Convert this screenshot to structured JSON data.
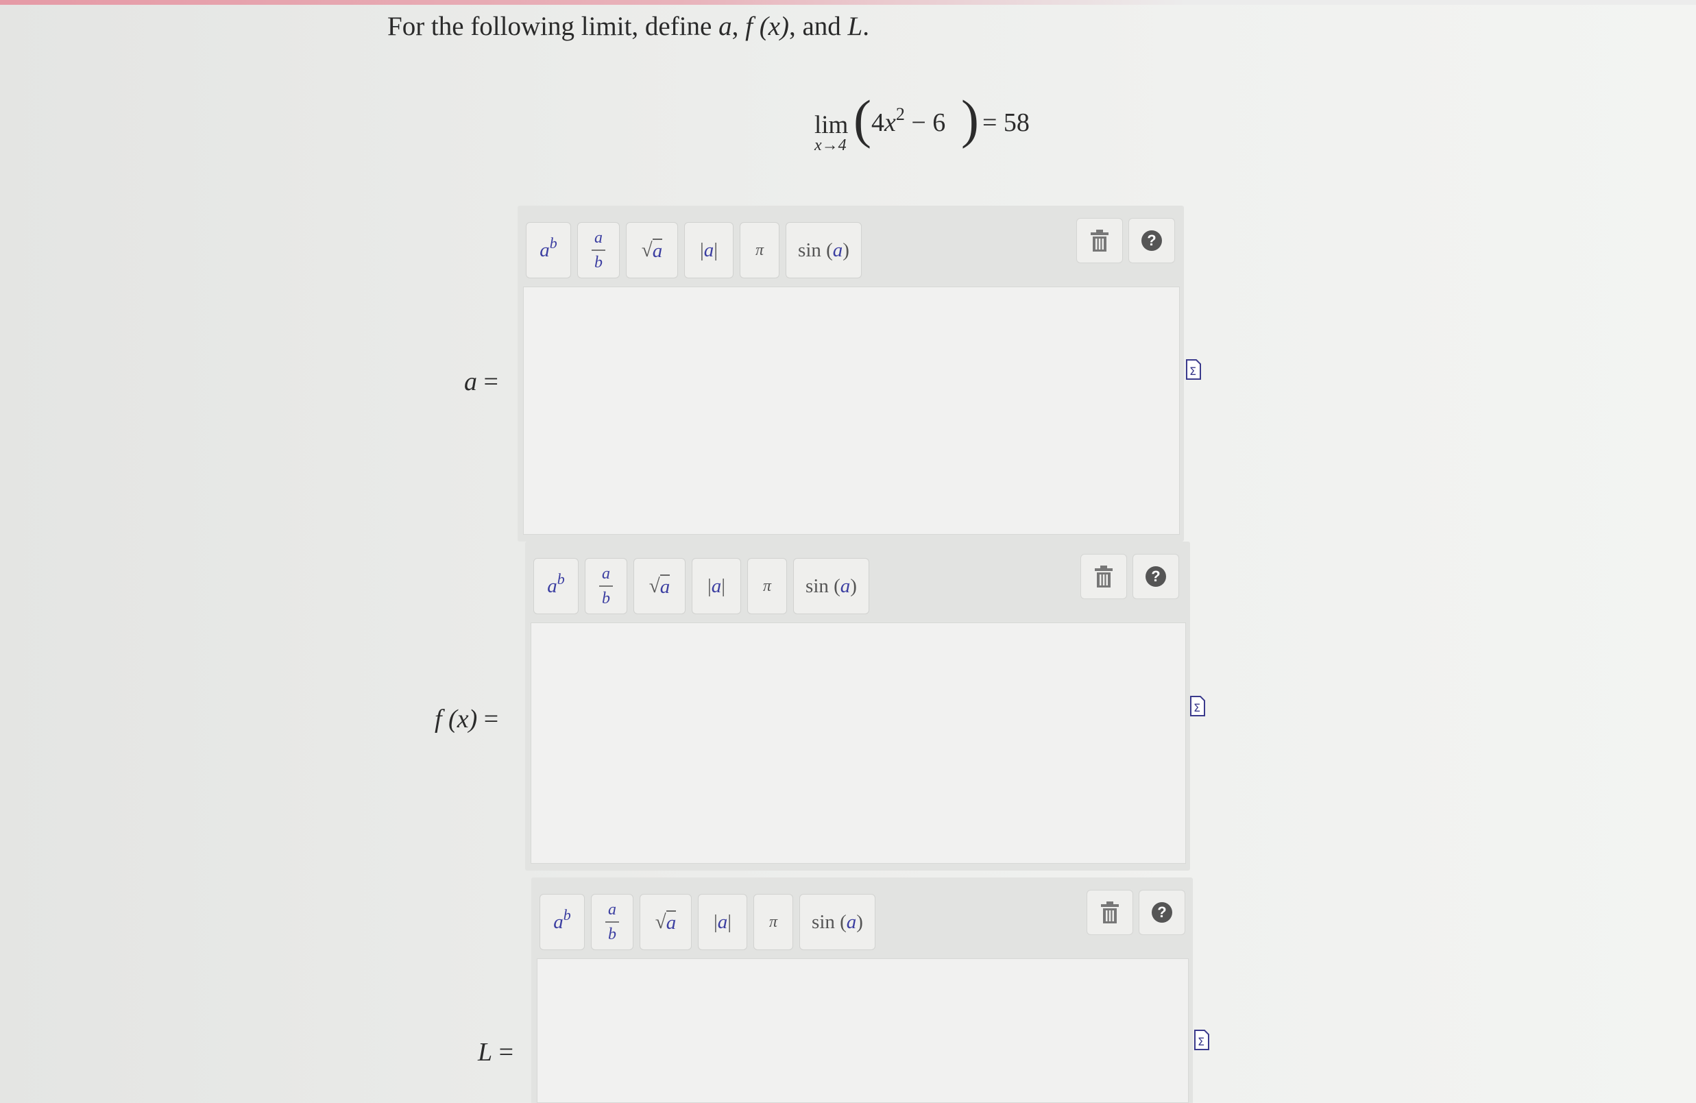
{
  "question": {
    "prefix": "For the following limit, define ",
    "var_a": "a",
    "sep1": ", ",
    "var_f": "f (x)",
    "sep2": ", and ",
    "var_L": "L",
    "suffix": "."
  },
  "limit": {
    "word": "lim",
    "subscript": "x→4",
    "coef": "4",
    "var": "x",
    "exponent": "2",
    "rest": " − 6",
    "equals": "= 58"
  },
  "toolbar": {
    "power_base": "a",
    "power_exp": "b",
    "frac_num": "a",
    "frac_den": "b",
    "sqrt_symbol": "√",
    "sqrt_arg": "a",
    "abs_arg": "a",
    "pi": "π",
    "sin_fn": "sin",
    "sin_arg": "a",
    "help": "?"
  },
  "fields": [
    {
      "label_var": "a",
      "label_eq": " =",
      "value": ""
    },
    {
      "label_var": "f (x)",
      "label_eq": " =",
      "value": ""
    },
    {
      "label_var": "L",
      "label_eq": " =",
      "value": ""
    }
  ],
  "icons": [
    "trash-icon",
    "help-icon",
    "equation-editor-icon"
  ],
  "colors": {
    "toolbar_var": "#3b3ea1",
    "top_accent": "#e59aa6"
  }
}
